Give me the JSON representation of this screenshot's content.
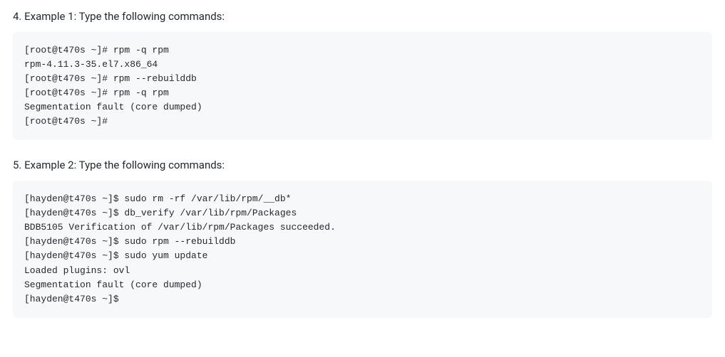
{
  "steps": [
    {
      "number": "4.",
      "text": "Example 1: Type the following commands:",
      "code": "[root@t470s ~]# rpm -q rpm\nrpm-4.11.3-35.el7.x86_64\n[root@t470s ~]# rpm --rebuilddb\n[root@t470s ~]# rpm -q rpm\nSegmentation fault (core dumped)\n[root@t470s ~]#"
    },
    {
      "number": "5.",
      "text": "Example 2: Type the following commands:",
      "code": "[hayden@t470s ~]$ sudo rm -rf /var/lib/rpm/__db*\n[hayden@t470s ~]$ db_verify /var/lib/rpm/Packages\nBDB5105 Verification of /var/lib/rpm/Packages succeeded.\n[hayden@t470s ~]$ sudo rpm --rebuilddb\n[hayden@t470s ~]$ sudo yum update\nLoaded plugins: ovl\nSegmentation fault (core dumped)\n[hayden@t470s ~]$"
    }
  ]
}
